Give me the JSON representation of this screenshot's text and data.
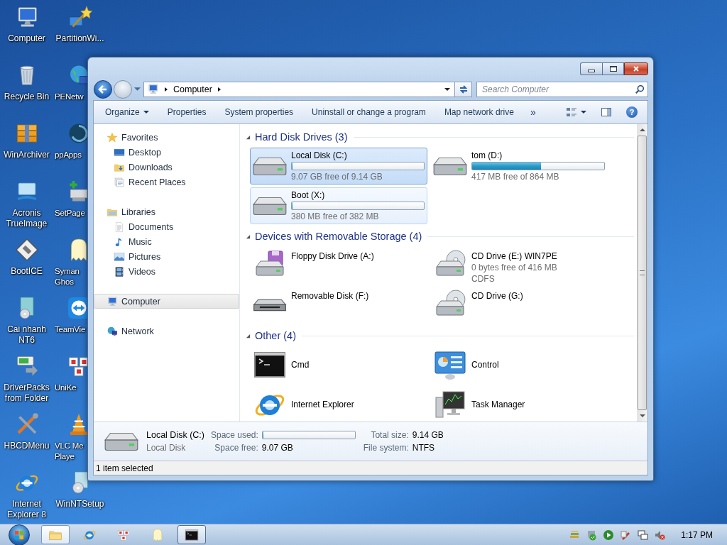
{
  "desktop_icons": [
    {
      "kind": "computer",
      "lines": [
        "Computer"
      ],
      "partly_hidden": false
    },
    {
      "kind": "recycle",
      "lines": [
        "Recycle Bin"
      ],
      "partly_hidden": false
    },
    {
      "kind": "boxes",
      "lines": [
        "WinArchiver"
      ],
      "partly_hidden": false
    },
    {
      "kind": "acronis",
      "lines": [
        "Acronis",
        "TrueImage"
      ],
      "partly_hidden": false
    },
    {
      "kind": "bootice",
      "lines": [
        "BootICE"
      ],
      "partly_hidden": false
    },
    {
      "kind": "setup",
      "lines": [
        "Cai nhanh",
        "NT6"
      ],
      "partly_hidden": false
    },
    {
      "kind": "driverpacks",
      "lines": [
        "DriverPacks",
        "from Folder"
      ],
      "partly_hidden": false
    },
    {
      "kind": "tools",
      "lines": [
        "HBCDMenu"
      ],
      "partly_hidden": false
    },
    {
      "kind": "ie",
      "lines": [
        "Internet",
        "Explorer 8"
      ],
      "partly_hidden": false
    },
    {
      "kind": "wand",
      "lines": [
        "PartitionWi..."
      ],
      "partly_hidden": false
    },
    {
      "kind": "globe",
      "lines": [
        "PENetw"
      ],
      "partly_hidden": true
    },
    {
      "kind": "swirl",
      "lines": [
        "ppApps"
      ],
      "partly_hidden": true
    },
    {
      "kind": "setpage",
      "lines": [
        "SetPage"
      ],
      "partly_hidden": true
    },
    {
      "kind": "ghost",
      "lines": [
        "Syman",
        "Ghos"
      ],
      "partly_hidden": true
    },
    {
      "kind": "teamviewer",
      "lines": [
        "TeamVie"
      ],
      "partly_hidden": true
    },
    {
      "kind": "unikey",
      "lines": [
        "UniKe"
      ],
      "partly_hidden": true
    },
    {
      "kind": "vlc",
      "lines": [
        "VLC Me",
        "Playe"
      ],
      "partly_hidden": true
    },
    {
      "kind": "winnt",
      "lines": [
        "WinNTSetup"
      ],
      "partly_hidden": false
    }
  ],
  "window": {
    "address": {
      "crumbs": [
        "Computer"
      ]
    },
    "search": {
      "placeholder": "Search Computer"
    },
    "toolbar": {
      "buttons": [
        {
          "label": "Organize",
          "dropdown": true
        },
        {
          "label": "Properties",
          "dropdown": false
        },
        {
          "label": "System properties",
          "dropdown": false
        },
        {
          "label": "Uninstall or change a program",
          "dropdown": false
        },
        {
          "label": "Map network drive",
          "dropdown": false
        }
      ],
      "more": "»",
      "help": "?"
    },
    "nav": [
      {
        "label": "Favorites",
        "kind": "star",
        "selected": false,
        "children": [
          {
            "label": "Desktop",
            "kind": "desktop",
            "selected": false
          },
          {
            "label": "Downloads",
            "kind": "downloads",
            "selected": false
          },
          {
            "label": "Recent Places",
            "kind": "recent",
            "selected": false
          }
        ]
      },
      {
        "label": "Libraries",
        "kind": "library",
        "selected": false,
        "children": [
          {
            "label": "Documents",
            "kind": "documents",
            "selected": false
          },
          {
            "label": "Music",
            "kind": "music",
            "selected": false
          },
          {
            "label": "Pictures",
            "kind": "pictures",
            "selected": false
          },
          {
            "label": "Videos",
            "kind": "videos",
            "selected": false
          }
        ]
      },
      {
        "label": "Computer",
        "kind": "computer",
        "selected": true
      },
      {
        "label": "Network",
        "kind": "network",
        "selected": false
      }
    ],
    "groups": [
      {
        "title": "Hard Disk Drives (3)",
        "expanded": true,
        "items": [
          {
            "kind": "hdd",
            "name": "Local Disk (C:)",
            "level": 0.008,
            "free": "9.07 GB free of 9.14 GB",
            "selected": true,
            "hovered": false
          },
          {
            "kind": "hdd",
            "name": "tom (D:)",
            "level": 0.52,
            "free": "417 MB free of 864 MB",
            "selected": false,
            "hovered": false
          },
          {
            "kind": "hdd",
            "name": "Boot (X:)",
            "level": 0.005,
            "free": "380 MB free of 382 MB",
            "selected": false,
            "hovered": true
          }
        ]
      },
      {
        "title": "Devices with Removable Storage (4)",
        "expanded": true,
        "items": [
          {
            "kind": "floppy",
            "name": "Floppy Disk Drive (A:)",
            "selected": false,
            "hovered": false
          },
          {
            "kind": "cd",
            "name": "CD Drive (E:) WIN7PE",
            "details": [
              "0 bytes free of 416 MB",
              "CDFS"
            ],
            "selected": false,
            "hovered": false
          },
          {
            "kind": "removable",
            "name": "Removable Disk (F:)",
            "selected": false,
            "hovered": false
          },
          {
            "kind": "cd",
            "name": "CD Drive (G:)",
            "selected": false,
            "hovered": false
          }
        ]
      },
      {
        "title": "Other (4)",
        "expanded": true,
        "items": [
          {
            "kind": "cmd",
            "name": "Cmd",
            "selected": false,
            "hovered": false
          },
          {
            "kind": "control",
            "name": "Control",
            "selected": false,
            "hovered": false
          },
          {
            "kind": "ie",
            "name": "Internet Explorer",
            "selected": false,
            "hovered": false
          },
          {
            "kind": "taskmgr",
            "name": "Task Manager",
            "selected": false,
            "hovered": false
          }
        ]
      }
    ],
    "details": {
      "kind": "hdd",
      "name": "Local Disk (C:)",
      "type": "Local Disk",
      "fields": [
        {
          "label": "Space used:",
          "level": 0.008
        },
        {
          "label": "Total size:",
          "value": "9.14 GB"
        },
        {
          "label": "Space free:",
          "value": "9.07 GB"
        },
        {
          "label": "File system:",
          "value": "NTFS"
        }
      ]
    },
    "status": "1 item selected"
  },
  "taskbar": {
    "buttons": [
      {
        "kind": "folder",
        "open": true,
        "focused": true
      },
      {
        "kind": "ie",
        "open": false,
        "focused": false
      },
      {
        "kind": "unikey",
        "open": false,
        "focused": false
      },
      {
        "kind": "ghost",
        "open": false,
        "focused": false
      },
      {
        "kind": "cmd",
        "open": true,
        "focused": false
      }
    ],
    "clock": "1:17 PM"
  }
}
